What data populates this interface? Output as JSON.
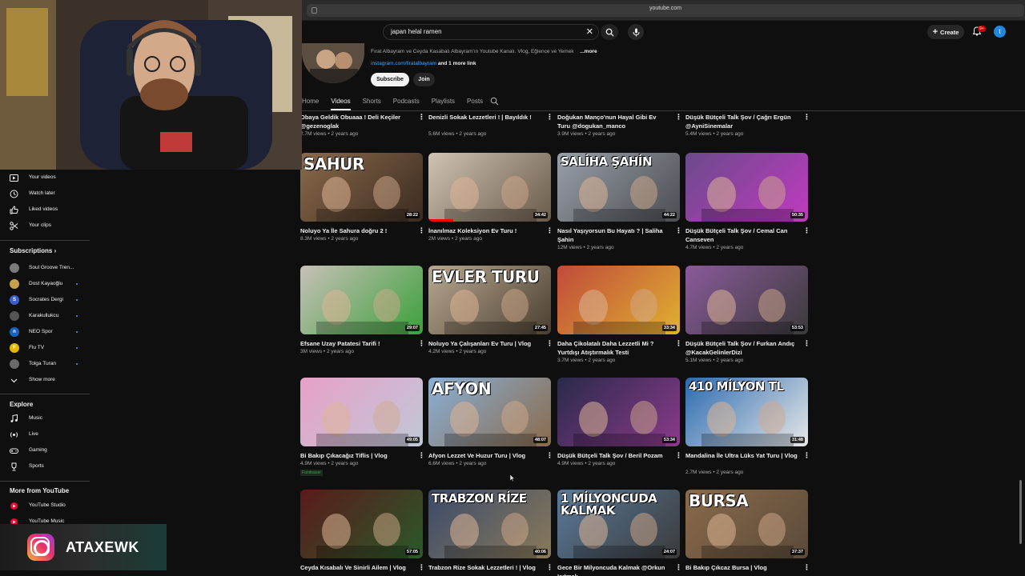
{
  "browser": {
    "url": "youtube.com"
  },
  "header": {
    "search_query": "japan helal ramen",
    "create_label": "Create",
    "notif_badge": "9+",
    "account_initial": "t"
  },
  "channel": {
    "description": "Fırat Albayram ve Ceyda Kasabalı Albayram'ın Youtube Kanalı. Vlog, Eğlence ve Yemek",
    "more_label": "...more",
    "link": "instagram.com/firatalbayram",
    "more_links": "and 1 more link",
    "subscribe_label": "Subscribe",
    "join_label": "Join"
  },
  "tabs": [
    "Home",
    "Videos",
    "Shorts",
    "Podcasts",
    "Playlists",
    "Posts"
  ],
  "sidebar": {
    "you_items": [
      {
        "label": "Your videos",
        "icon": "play-square-icon"
      },
      {
        "label": "Watch later",
        "icon": "clock-icon"
      },
      {
        "label": "Liked videos",
        "icon": "thumbs-up-icon"
      },
      {
        "label": "Your clips",
        "icon": "scissors-icon"
      }
    ],
    "subscriptions_title": "Subscriptions",
    "subscriptions": [
      {
        "label": "Soul Groove Tren...",
        "color": "#7a7a7a",
        "initial": "",
        "dot": false
      },
      {
        "label": "Dost Kayaoğlu",
        "color": "#c8a24a",
        "initial": "",
        "dot": true
      },
      {
        "label": "Socrates Dergi",
        "color": "#3a5fcd",
        "initial": "S",
        "dot": true
      },
      {
        "label": "Karakullukcu",
        "color": "#555555",
        "initial": "",
        "dot": true
      },
      {
        "label": "NEO Spor",
        "color": "#1565c0",
        "initial": "n",
        "dot": true
      },
      {
        "label": "Flu TV",
        "color": "#e5b800",
        "initial": "F",
        "dot": true
      },
      {
        "label": "Tolga Turan",
        "color": "#6a6a6a",
        "initial": "",
        "dot": true
      }
    ],
    "show_more": "Show more",
    "explore_title": "Explore",
    "explore_items": [
      {
        "label": "Music",
        "icon": "music-icon"
      },
      {
        "label": "Live",
        "icon": "live-icon"
      },
      {
        "label": "Gaming",
        "icon": "gamepad-icon"
      },
      {
        "label": "Sports",
        "icon": "trophy-icon"
      }
    ],
    "more_title": "More from YouTube",
    "more_items": [
      {
        "label": "YouTube Studio"
      },
      {
        "label": "YouTube Music"
      }
    ]
  },
  "overlay": {
    "instagram_handle": "ATAXEWK"
  },
  "videos": [
    {
      "title": "Obaya Geldik Obuaaa ! Deli Keçiler @gezenoglak",
      "meta": "2.7M views • 2 years ago",
      "duration": "",
      "thumb_text": "",
      "colors": [
        "#3b3b3b",
        "#5a4a3a"
      ]
    },
    {
      "title": "Denizli Sokak Lezzetleri ! | Bayıldık !",
      "meta": "5.6M views • 2 years ago",
      "duration": "",
      "thumb_text": "",
      "colors": [
        "#3b3b3b",
        "#5a4a3a"
      ]
    },
    {
      "title": "Doğukan Manço'nun Hayal Gibi Ev Turu @dogukan_manco",
      "meta": "3.9M views • 2 years ago",
      "duration": "",
      "thumb_text": "",
      "colors": [
        "#3b3b3b",
        "#5a4a3a"
      ]
    },
    {
      "title": "Düşük Bütçeli Talk Şov / Çağrı Ergün @AyniSinemalar",
      "meta": "5.4M views • 2 years ago",
      "duration": "",
      "thumb_text": "",
      "colors": [
        "#3b3b3b",
        "#5a4a3a"
      ]
    },
    {
      "title": "Noluyo Ya İle Sahura doğru 2 !",
      "meta": "8.3M views • 2 years ago",
      "duration": "28:22",
      "thumb_text": "SAHUR",
      "colors": [
        "#8a6a4a",
        "#3a2a20"
      ]
    },
    {
      "title": "İnanılmaz Koleksiyon Ev Turu !",
      "meta": "2M views • 2 years ago",
      "duration": "34:42",
      "thumb_text": "",
      "colors": [
        "#cfc3b3",
        "#6a5a4a"
      ],
      "progress": 0.2
    },
    {
      "title": "Nasıl Yaşıyorsun Bu Hayatı ? | Saliha Şahin",
      "meta": "12M views • 2 years ago",
      "duration": "44:22",
      "thumb_text": "SALİHA ŞAHİN",
      "colors": [
        "#9aa0a8",
        "#4a4d52"
      ]
    },
    {
      "title": "Düşük Bütçeli Talk Şov / Cemal Can Canseven",
      "meta": "4.7M views • 2 years ago",
      "duration": "50:35",
      "thumb_text": "",
      "colors": [
        "#6a4a8a",
        "#c03ac0"
      ]
    },
    {
      "title": "Efsane Uzay Patatesi Tarifi !",
      "meta": "3M views • 2 years ago",
      "duration": "29:07",
      "thumb_text": "",
      "colors": [
        "#c8c0b8",
        "#3aa03a"
      ]
    },
    {
      "title": "Noluyo Ya Çalışanları Ev Turu | Vlog",
      "meta": "4.2M views • 2 years ago",
      "duration": "27:45",
      "thumb_text": "EVLER TURU",
      "colors": [
        "#b8a890",
        "#4a3e30"
      ]
    },
    {
      "title": "Daha Çikolatalı Daha Lezzetli Mi ? Yurtdışı Atıştırmalık Testi",
      "meta": "3.7M views • 2 years ago",
      "duration": "33:34",
      "thumb_text": "",
      "colors": [
        "#c04a3a",
        "#e0b030"
      ]
    },
    {
      "title": "Düşük Bütçeli Talk Şov / Furkan Andıç @KacakGelinlerDizi",
      "meta": "5.1M views • 2 years ago",
      "duration": "53:53",
      "thumb_text": "",
      "colors": [
        "#8a5a9a",
        "#3a3a3a"
      ]
    },
    {
      "title": "Bi Bakıp Çıkacağız Tiflis | Vlog",
      "meta": "4.9M views • 2 years ago",
      "duration": "49:05",
      "thumb_text": "",
      "colors": [
        "#e8a0c8",
        "#c0c8d8"
      ],
      "fundraiser": "Fundraiser"
    },
    {
      "title": "Afyon Lezzet Ve Huzur Turu | Vlog",
      "meta": "6.6M views • 2 years ago",
      "duration": "48:07",
      "thumb_text": "AFYON",
      "colors": [
        "#8ab0d8",
        "#8a6a4a"
      ]
    },
    {
      "title": "Düşük Bütçeli Talk Şov / Beril Pozam",
      "meta": "4.9M views • 2 years ago",
      "duration": "53:34",
      "thumb_text": "",
      "colors": [
        "#2a2a4a",
        "#8a3a8a"
      ]
    },
    {
      "title": "Mandalina İle Ultra Lüks Yat Turu | Vlog",
      "meta": "2.7M views • 2 years ago",
      "duration": "31:48",
      "thumb_text": "410 MİLYON TL",
      "colors": [
        "#2a6ab0",
        "#e8e8e8"
      ]
    },
    {
      "title": "Ceyda Kısabalı Ve Sinirli Ailem | Vlog",
      "meta": "",
      "duration": "57:05",
      "thumb_text": "",
      "colors": [
        "#5a1a1a",
        "#2a5a2a"
      ]
    },
    {
      "title": "Trabzon Rize Sokak Lezzetleri ! | Vlog",
      "meta": "",
      "duration": "40:06",
      "thumb_text": "TRABZON RİZE",
      "colors": [
        "#3a4a6a",
        "#8a7a5a"
      ]
    },
    {
      "title": "Gece Bir Milyoncuda Kalmak @Orkun Işıtmak",
      "meta": "",
      "duration": "24:07",
      "thumb_text": "1 MİLYONCUDA KALMAK",
      "colors": [
        "#5a7a9a",
        "#3a3a3a"
      ]
    },
    {
      "title": "Bi Bakıp Çıkcaz Bursa | Vlog",
      "meta": "",
      "duration": "37:37",
      "thumb_text": "BURSA",
      "colors": [
        "#8a6a4a",
        "#5a4a3a"
      ]
    }
  ]
}
